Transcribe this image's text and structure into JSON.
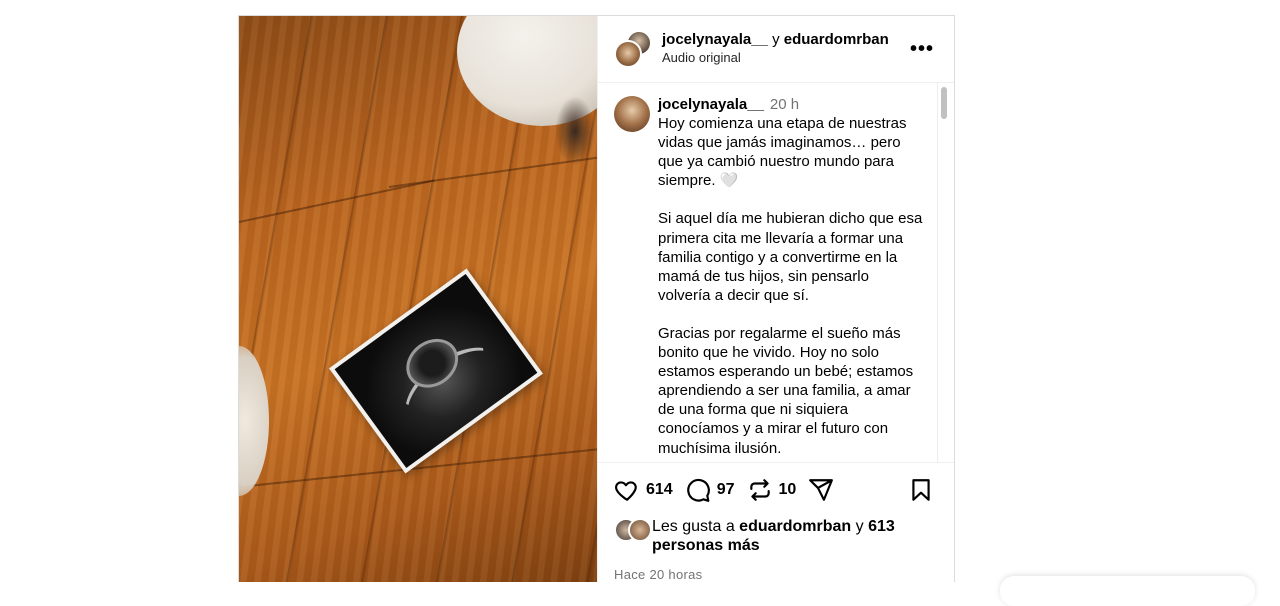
{
  "header": {
    "user1": "jocelynayala__",
    "connector": " y ",
    "user2": "eduardomrban",
    "audio": "Audio original",
    "more": "•••"
  },
  "caption": {
    "author": "jocelynayala__",
    "time": "20 h",
    "paragraphs": [
      "Hoy comienza una etapa de nuestras vidas que jamás imaginamos… pero que ya cambió nuestro mundo para siempre. 🤍",
      "Si aquel día me hubieran dicho que esa primera cita me llevaría a formar una familia contigo y a convertirme en la mamá de tus hijos, sin pensarlo volvería a decir que sí.",
      "Gracias por regalarme el sueño más bonito que he vivido. Hoy no solo estamos esperando un bebé; estamos aprendiendo a ser una familia, a amar de una forma que ni siquiera conocíamos y a mirar el futuro con muchísima ilusión."
    ]
  },
  "actions": {
    "likes": "614",
    "comments": "97",
    "reposts": "10"
  },
  "liked_by": {
    "prefix": "Les gusta a ",
    "user": "eduardomrban",
    "connector": " y ",
    "others": "613 personas más"
  },
  "timestamp": "Hace 20 horas"
}
